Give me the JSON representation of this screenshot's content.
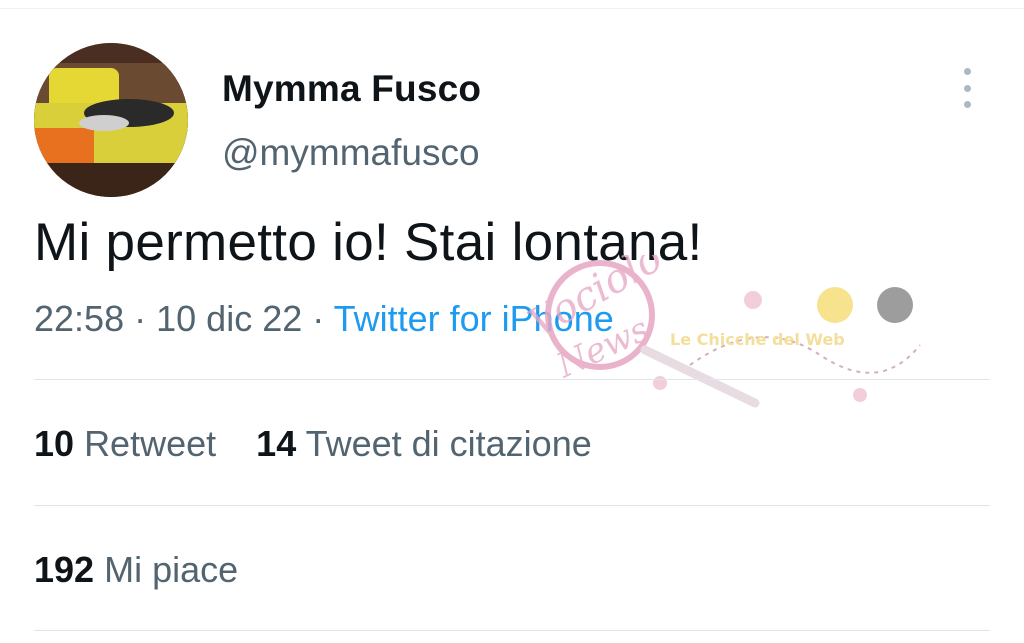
{
  "user": {
    "display_name": "Mymma Fusco",
    "handle": "@mymmafusco"
  },
  "tweet": {
    "text": "Mi permetto io! Stai lontana!",
    "time": "22:58",
    "date": "10 dic 22",
    "separator": "·",
    "source": "Twitter for iPhone"
  },
  "stats": {
    "retweets_count": "10",
    "retweets_label": "Retweet",
    "quotes_count": "14",
    "quotes_label": "Tweet di citazione",
    "likes_count": "192",
    "likes_label": "Mi piace"
  },
  "watermark": {
    "logo_text": "Vociolo delle News",
    "banner_text": "Le Chicche del Web"
  },
  "colors": {
    "text_primary": "#0f1419",
    "text_secondary": "#536471",
    "link": "#1d9bf0",
    "divider": "#dfe5e8"
  },
  "icons": {
    "more": "more-vertical-icon"
  }
}
